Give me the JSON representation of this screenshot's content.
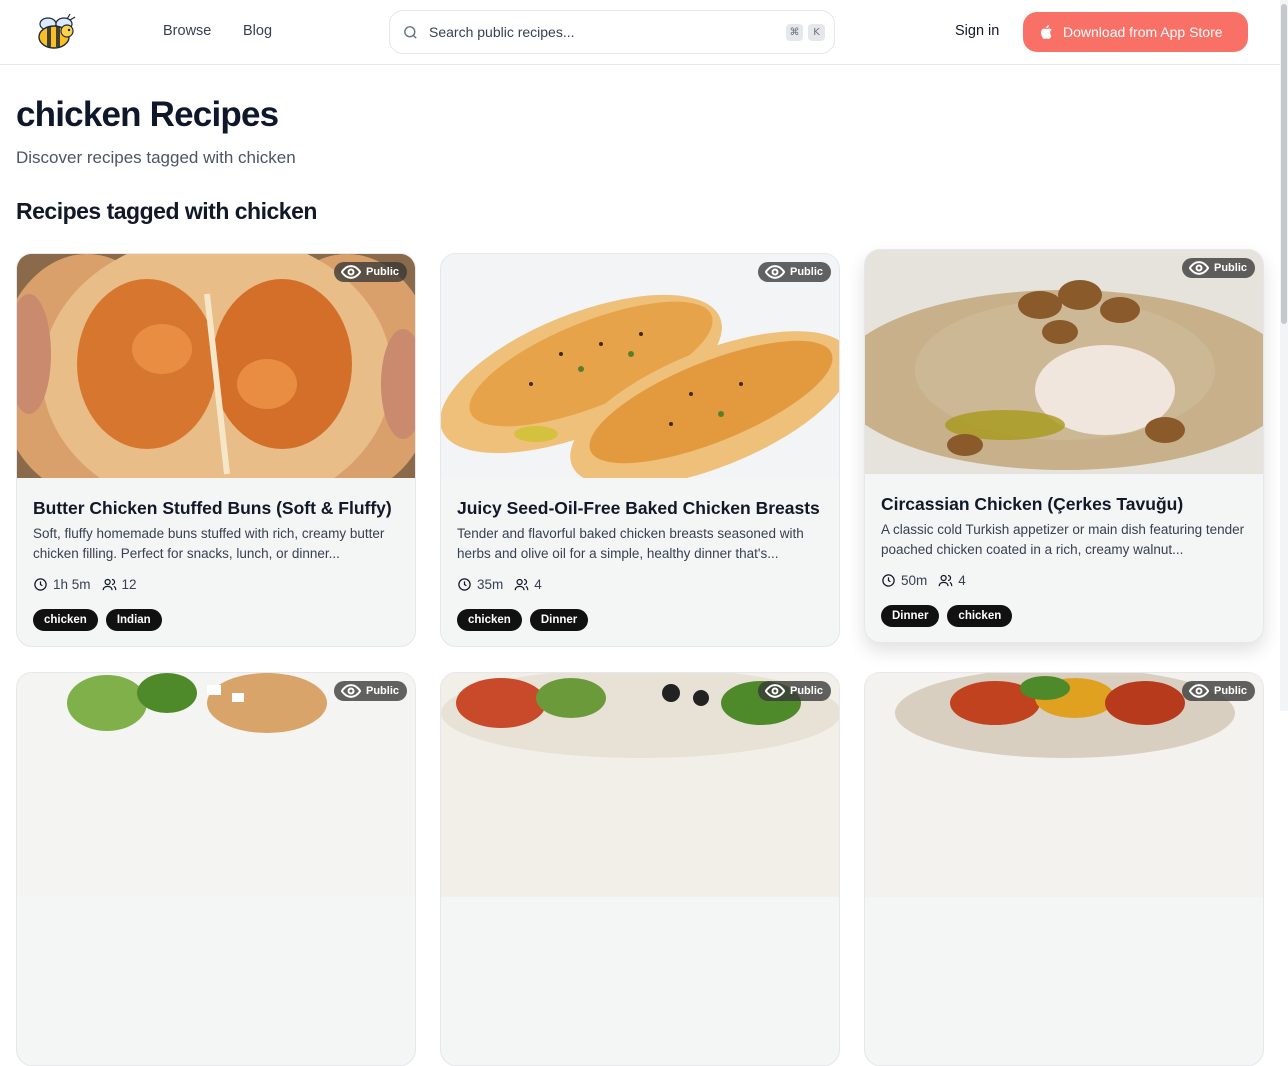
{
  "nav": {
    "browse": "Browse",
    "blog": "Blog",
    "sign_in": "Sign in",
    "download": "Download from App Store"
  },
  "search": {
    "placeholder": "Search public recipes...",
    "kbd_cmd": "⌘",
    "kbd_k": "K"
  },
  "page": {
    "title": "chicken Recipes",
    "subtitle": "Discover recipes tagged with chicken",
    "section_title": "Recipes tagged with chicken"
  },
  "cards": [
    {
      "visibility": "Public",
      "title": "Butter Chicken Stuffed Buns (Soft & Fluffy)",
      "description": "Soft, fluffy homemade buns stuffed with rich, creamy butter chicken filling. Perfect for snacks, lunch, or dinner...",
      "time": "1h 5m",
      "servings": "12",
      "tags": [
        "chicken",
        "Indian"
      ]
    },
    {
      "visibility": "Public",
      "title": "Juicy Seed-Oil-Free Baked Chicken Breasts",
      "description": "Tender and flavorful baked chicken breasts seasoned with herbs and olive oil for a simple, healthy dinner that's...",
      "time": "35m",
      "servings": "4",
      "tags": [
        "chicken",
        "Dinner"
      ]
    },
    {
      "visibility": "Public",
      "title": "Circassian Chicken (Çerkes Tavuğu)",
      "description": "A classic cold Turkish appetizer or main dish featuring tender poached chicken coated in a rich, creamy walnut...",
      "time": "50m",
      "servings": "4",
      "tags": [
        "Dinner",
        "chicken"
      ]
    },
    {
      "visibility": "Public"
    },
    {
      "visibility": "Public"
    },
    {
      "visibility": "Public"
    }
  ],
  "colors": {
    "accent": "#f97066",
    "tag_bg": "#111111",
    "card_bg": "#f4f5f5"
  }
}
